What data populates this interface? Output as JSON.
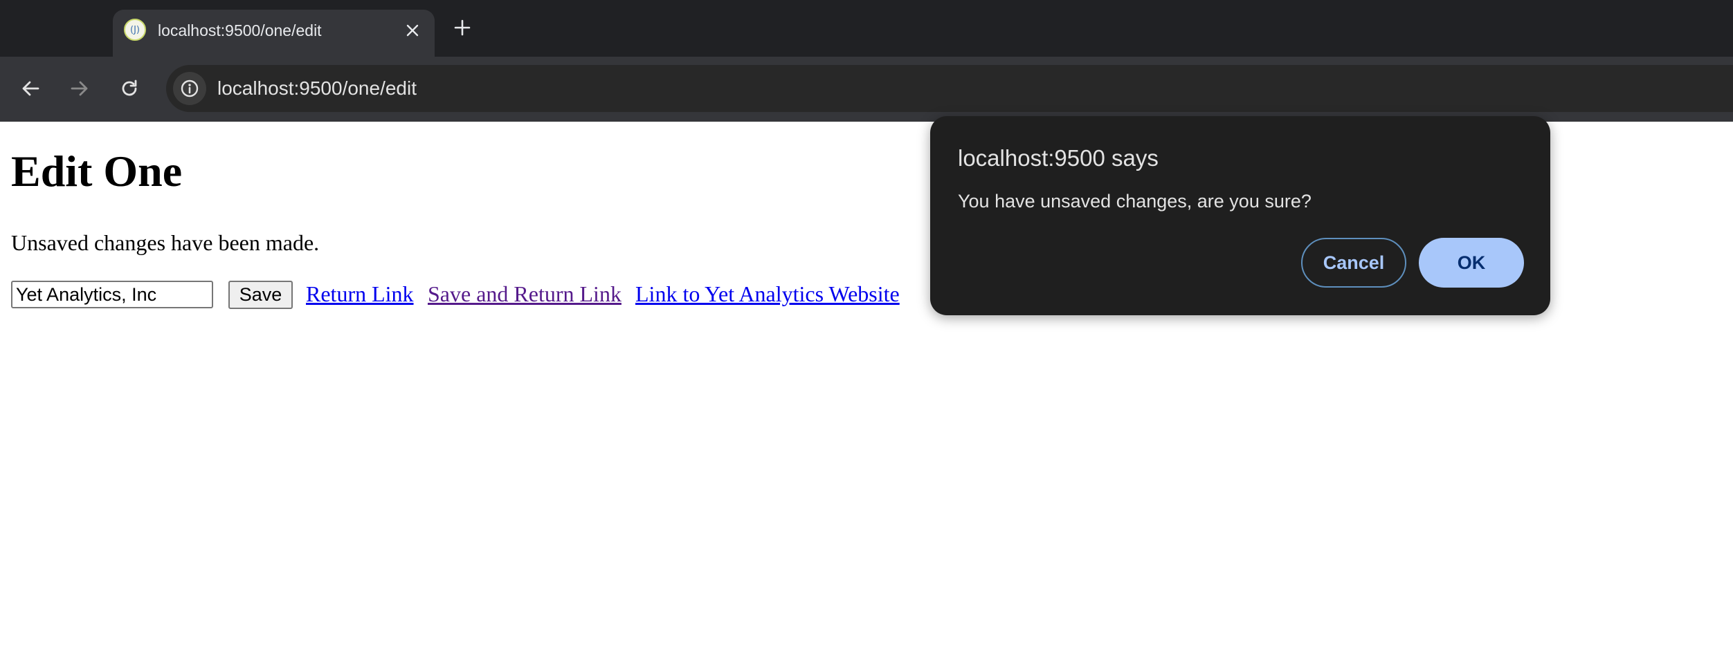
{
  "browser": {
    "tab": {
      "title": "localhost:9500/one/edit",
      "favicon_label": "(J)"
    },
    "url": "localhost:9500/one/edit",
    "icons": {
      "close": "close-icon",
      "new_tab": "plus-icon",
      "back": "arrow-left-icon",
      "forward": "arrow-right-icon",
      "reload": "reload-icon",
      "site_info": "info-icon"
    }
  },
  "page": {
    "heading": "Edit One",
    "status_message": "Unsaved changes have been made.",
    "name_input_value": "Yet Analytics, Inc",
    "save_label": "Save",
    "links": {
      "return": "Return Link",
      "save_and_return": "Save and Return Link",
      "website": "Link to Yet Analytics Website"
    }
  },
  "dialog": {
    "title": "localhost:9500 says",
    "message": "You have unsaved changes, are you sure?",
    "cancel_label": "Cancel",
    "ok_label": "OK"
  },
  "colors": {
    "link": "#0000ee",
    "visited_link": "#551a8b",
    "dialog_bg": "#1f1f1f",
    "ok_button_bg": "#a8c7fa",
    "chrome_bg": "#202124"
  }
}
